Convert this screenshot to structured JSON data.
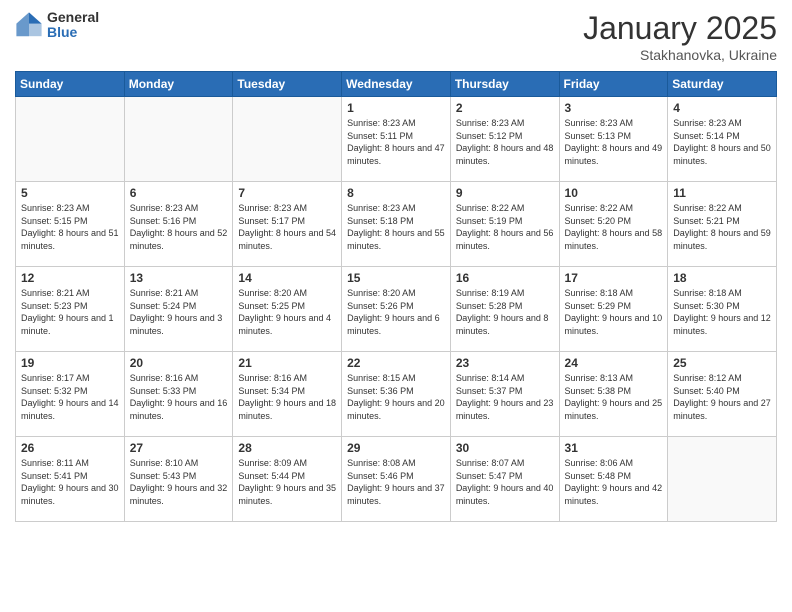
{
  "header": {
    "logo_general": "General",
    "logo_blue": "Blue",
    "month_title": "January 2025",
    "location": "Stakhanovka, Ukraine"
  },
  "days_of_week": [
    "Sunday",
    "Monday",
    "Tuesday",
    "Wednesday",
    "Thursday",
    "Friday",
    "Saturday"
  ],
  "weeks": [
    [
      {
        "day": "",
        "info": ""
      },
      {
        "day": "",
        "info": ""
      },
      {
        "day": "",
        "info": ""
      },
      {
        "day": "1",
        "info": "Sunrise: 8:23 AM\nSunset: 5:11 PM\nDaylight: 8 hours and 47 minutes."
      },
      {
        "day": "2",
        "info": "Sunrise: 8:23 AM\nSunset: 5:12 PM\nDaylight: 8 hours and 48 minutes."
      },
      {
        "day": "3",
        "info": "Sunrise: 8:23 AM\nSunset: 5:13 PM\nDaylight: 8 hours and 49 minutes."
      },
      {
        "day": "4",
        "info": "Sunrise: 8:23 AM\nSunset: 5:14 PM\nDaylight: 8 hours and 50 minutes."
      }
    ],
    [
      {
        "day": "5",
        "info": "Sunrise: 8:23 AM\nSunset: 5:15 PM\nDaylight: 8 hours and 51 minutes."
      },
      {
        "day": "6",
        "info": "Sunrise: 8:23 AM\nSunset: 5:16 PM\nDaylight: 8 hours and 52 minutes."
      },
      {
        "day": "7",
        "info": "Sunrise: 8:23 AM\nSunset: 5:17 PM\nDaylight: 8 hours and 54 minutes."
      },
      {
        "day": "8",
        "info": "Sunrise: 8:23 AM\nSunset: 5:18 PM\nDaylight: 8 hours and 55 minutes."
      },
      {
        "day": "9",
        "info": "Sunrise: 8:22 AM\nSunset: 5:19 PM\nDaylight: 8 hours and 56 minutes."
      },
      {
        "day": "10",
        "info": "Sunrise: 8:22 AM\nSunset: 5:20 PM\nDaylight: 8 hours and 58 minutes."
      },
      {
        "day": "11",
        "info": "Sunrise: 8:22 AM\nSunset: 5:21 PM\nDaylight: 8 hours and 59 minutes."
      }
    ],
    [
      {
        "day": "12",
        "info": "Sunrise: 8:21 AM\nSunset: 5:23 PM\nDaylight: 9 hours and 1 minute."
      },
      {
        "day": "13",
        "info": "Sunrise: 8:21 AM\nSunset: 5:24 PM\nDaylight: 9 hours and 3 minutes."
      },
      {
        "day": "14",
        "info": "Sunrise: 8:20 AM\nSunset: 5:25 PM\nDaylight: 9 hours and 4 minutes."
      },
      {
        "day": "15",
        "info": "Sunrise: 8:20 AM\nSunset: 5:26 PM\nDaylight: 9 hours and 6 minutes."
      },
      {
        "day": "16",
        "info": "Sunrise: 8:19 AM\nSunset: 5:28 PM\nDaylight: 9 hours and 8 minutes."
      },
      {
        "day": "17",
        "info": "Sunrise: 8:18 AM\nSunset: 5:29 PM\nDaylight: 9 hours and 10 minutes."
      },
      {
        "day": "18",
        "info": "Sunrise: 8:18 AM\nSunset: 5:30 PM\nDaylight: 9 hours and 12 minutes."
      }
    ],
    [
      {
        "day": "19",
        "info": "Sunrise: 8:17 AM\nSunset: 5:32 PM\nDaylight: 9 hours and 14 minutes."
      },
      {
        "day": "20",
        "info": "Sunrise: 8:16 AM\nSunset: 5:33 PM\nDaylight: 9 hours and 16 minutes."
      },
      {
        "day": "21",
        "info": "Sunrise: 8:16 AM\nSunset: 5:34 PM\nDaylight: 9 hours and 18 minutes."
      },
      {
        "day": "22",
        "info": "Sunrise: 8:15 AM\nSunset: 5:36 PM\nDaylight: 9 hours and 20 minutes."
      },
      {
        "day": "23",
        "info": "Sunrise: 8:14 AM\nSunset: 5:37 PM\nDaylight: 9 hours and 23 minutes."
      },
      {
        "day": "24",
        "info": "Sunrise: 8:13 AM\nSunset: 5:38 PM\nDaylight: 9 hours and 25 minutes."
      },
      {
        "day": "25",
        "info": "Sunrise: 8:12 AM\nSunset: 5:40 PM\nDaylight: 9 hours and 27 minutes."
      }
    ],
    [
      {
        "day": "26",
        "info": "Sunrise: 8:11 AM\nSunset: 5:41 PM\nDaylight: 9 hours and 30 minutes."
      },
      {
        "day": "27",
        "info": "Sunrise: 8:10 AM\nSunset: 5:43 PM\nDaylight: 9 hours and 32 minutes."
      },
      {
        "day": "28",
        "info": "Sunrise: 8:09 AM\nSunset: 5:44 PM\nDaylight: 9 hours and 35 minutes."
      },
      {
        "day": "29",
        "info": "Sunrise: 8:08 AM\nSunset: 5:46 PM\nDaylight: 9 hours and 37 minutes."
      },
      {
        "day": "30",
        "info": "Sunrise: 8:07 AM\nSunset: 5:47 PM\nDaylight: 9 hours and 40 minutes."
      },
      {
        "day": "31",
        "info": "Sunrise: 8:06 AM\nSunset: 5:48 PM\nDaylight: 9 hours and 42 minutes."
      },
      {
        "day": "",
        "info": ""
      }
    ]
  ]
}
